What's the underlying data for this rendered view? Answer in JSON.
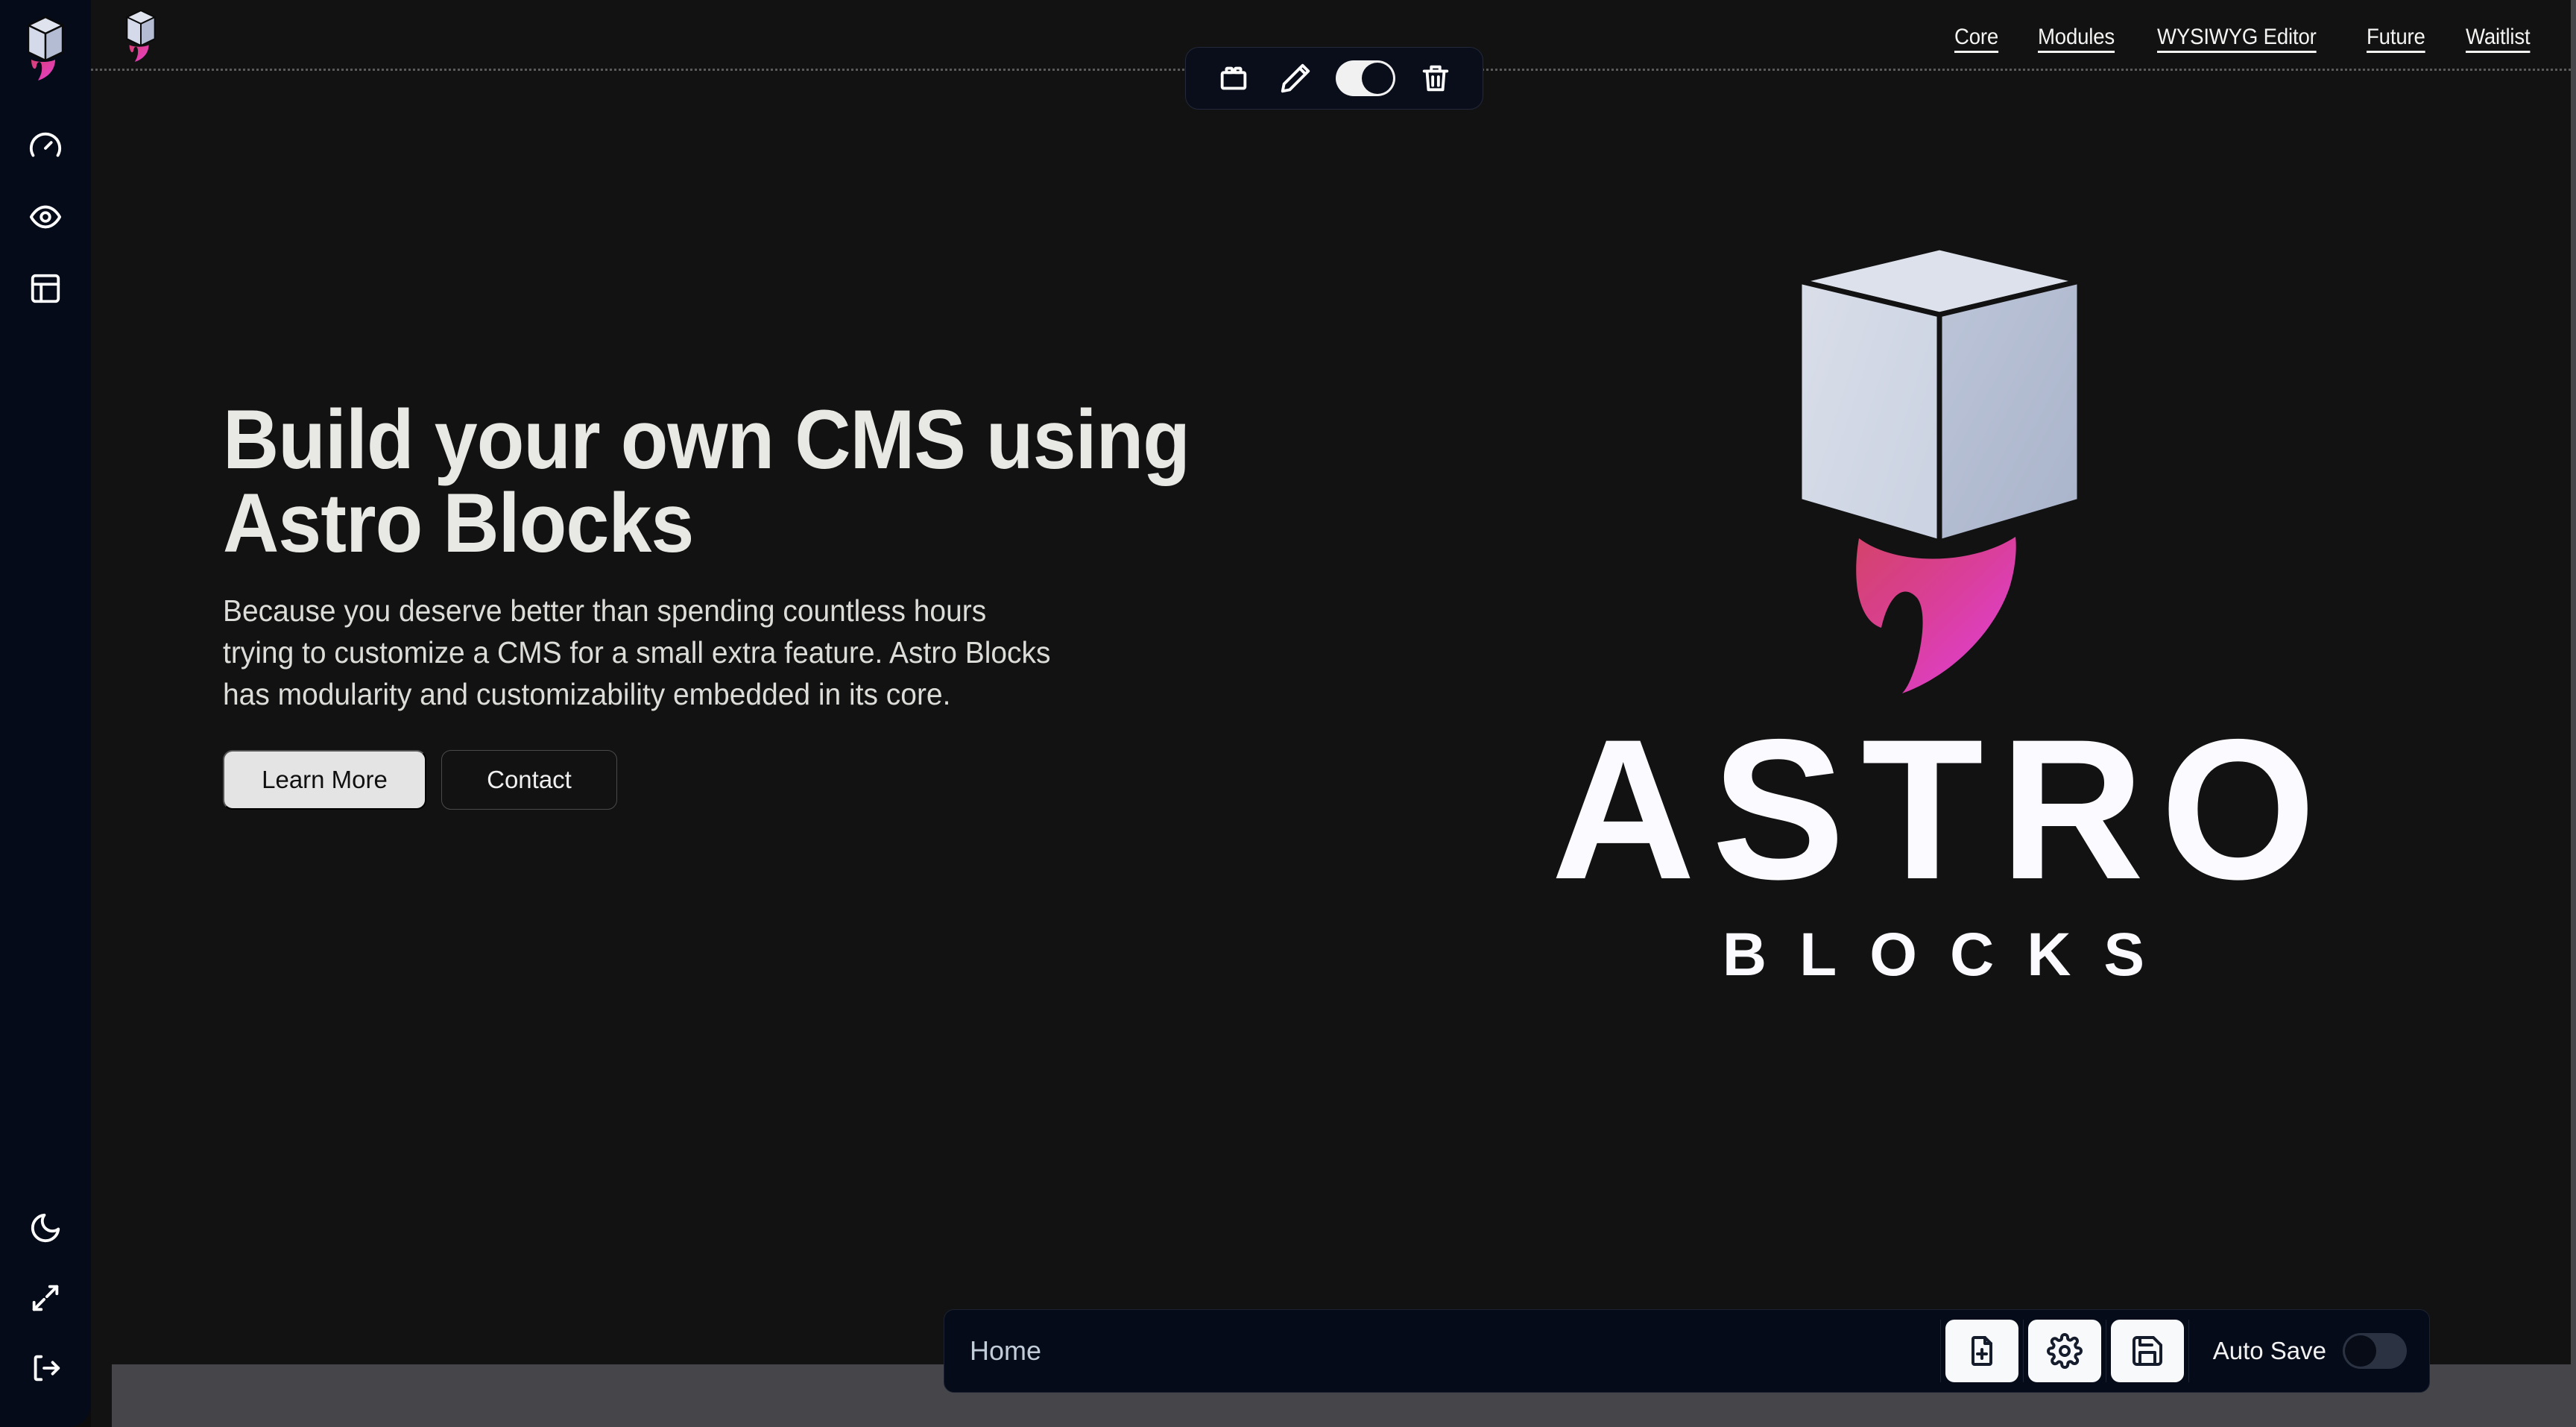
{
  "app": {
    "brand_name": "Astro Blocks",
    "accent_pink": "#e0399b",
    "accent_magenta": "#cf3f7f",
    "cube_light": "#d6dbe8",
    "cube_shade": "#aeb7cc",
    "canvas_bg": "#121212",
    "sidebar_bg": "#050b18",
    "panel_bg": "#050b18"
  },
  "sidebar": {
    "logo_icon": "astro-blocks-cube-flame-logo",
    "items": [
      {
        "icon": "gauge-icon",
        "name": "dashboard"
      },
      {
        "icon": "eye-icon",
        "name": "preview"
      },
      {
        "icon": "layout-panel-icon",
        "name": "layout"
      }
    ],
    "bottom_items": [
      {
        "icon": "moon-icon",
        "name": "dark-mode-toggle"
      },
      {
        "icon": "expand-arrows-icon",
        "name": "fullscreen-toggle"
      },
      {
        "icon": "logout-icon",
        "name": "logout"
      }
    ]
  },
  "header": {
    "logo_icon": "astro-blocks-cube-flame-logo",
    "nav": [
      {
        "label": "Core"
      },
      {
        "label": "Modules"
      },
      {
        "label": "WYSIWYG Editor"
      },
      {
        "label": "Future"
      },
      {
        "label": "Waitlist"
      }
    ]
  },
  "block_toolbar": {
    "buttons": [
      {
        "icon": "lego-block-icon",
        "name": "add-block"
      },
      {
        "icon": "pencil-icon",
        "name": "edit-block"
      }
    ],
    "toggle": {
      "name": "visibility-toggle",
      "state": "on"
    },
    "delete": {
      "icon": "trash-icon",
      "name": "delete-block"
    }
  },
  "hero": {
    "title_line1": "Build your own CMS using",
    "title_line2": "Astro Blocks",
    "paragraph_line1": "Because you deserve better than spending countless hours",
    "paragraph_line2": "trying to customize a CMS for a small extra feature. Astro Blocks",
    "paragraph_line3": "has modularity and customizability embedded in its core.",
    "primary_button": "Learn More",
    "secondary_button": "Contact"
  },
  "brand": {
    "wordmark_top": "ASTRO",
    "wordmark_bottom": "BLOCKS",
    "mark_icon": "astro-blocks-cube-flame-logo"
  },
  "page_bar": {
    "page_name": "Home",
    "buttons": [
      {
        "icon": "file-plus-icon",
        "name": "new-page"
      },
      {
        "icon": "gear-icon",
        "name": "page-settings"
      },
      {
        "icon": "save-floppy-icon",
        "name": "save-page"
      }
    ],
    "autosave_label": "Auto Save",
    "autosave_state": "off"
  }
}
